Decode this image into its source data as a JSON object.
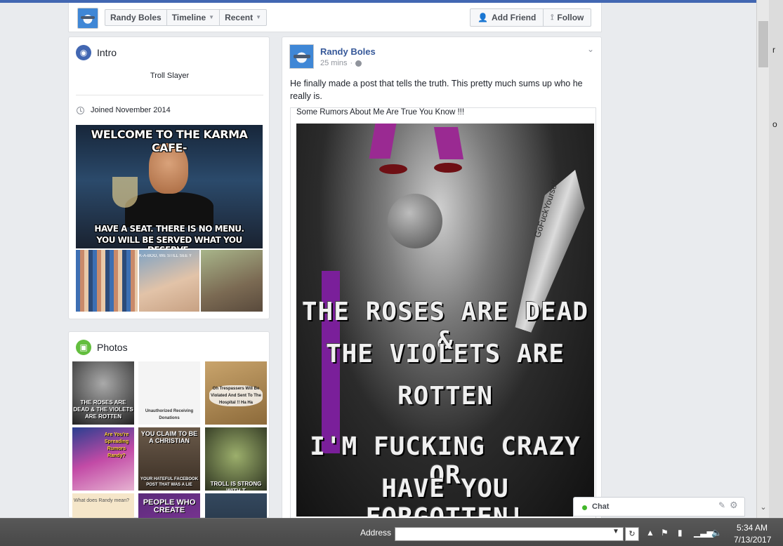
{
  "profile_nav": {
    "name": "Randy Boles",
    "timeline_label": "Timeline",
    "recent_label": "Recent",
    "add_friend_label": "Add Friend",
    "follow_label": "Follow"
  },
  "intro": {
    "title": "Intro",
    "bio": "Troll Slayer",
    "joined": "Joined November 2014",
    "featured_image": {
      "top_text": "WELCOME TO THE KARMA CAFE-",
      "bottom_line1": "HAVE A SEAT. THERE IS NO MENU.",
      "bottom_line2": "YOU WILL BE SERVED WHAT YOU DESERVE."
    },
    "mini_photo_2_text": "K-A-BOO, WE STILL SEE Y"
  },
  "photos": {
    "title": "Photos",
    "tiles": [
      {
        "caption": "THE ROSES ARE DEAD & THE VIOLETS ARE ROTTEN"
      },
      {
        "caption": "Unauthorized Receiving Donations"
      },
      {
        "caption": "Oh Trespassers Will Be Violated And Sent To The Hospital !! Ha Ha"
      },
      {
        "caption": "Are You're Spreading Rumors Randy?"
      },
      {
        "caption": "YOU CLAIM TO BE A CHRISTIAN"
      },
      {
        "caption": "TROLL IS STRONG WITH T"
      },
      {
        "caption": "What does Randy mean?"
      },
      {
        "caption": "PEOPLE WHO CREATE"
      },
      {
        "caption": ""
      }
    ],
    "tile_bottom_text_5": "YOUR HATEFUL FACEBOOK POST THAT WAS A LIE"
  },
  "post": {
    "author": "Randy Boles",
    "time": "25 mins",
    "text": "He finally made a post that tells the truth. This pretty much sums up who he really is.",
    "shared_caption": "Some Rumors About Me Are True You Know !!!",
    "image_lines": [
      "THE ROSES ARE DEAD &",
      "THE VIOLETS ARE",
      "ROTTEN",
      "I'M FUCKING CRAZY OR",
      "HAVE YOU FORGOTTEN!"
    ],
    "knife_text": "GoFuckYourself"
  },
  "chat": {
    "label": "Chat"
  },
  "taskbar": {
    "address_label": "Address",
    "address_value": "",
    "time": "5:34 AM",
    "date": "7/13/2017"
  },
  "colors": {
    "fb_blue": "#4267b2",
    "link_blue": "#365899",
    "online_green": "#42b72a"
  },
  "icons": {
    "intro": "globe-icon",
    "photos": "photos-icon",
    "add_friend": "add-friend-icon",
    "follow": "rss-icon"
  }
}
